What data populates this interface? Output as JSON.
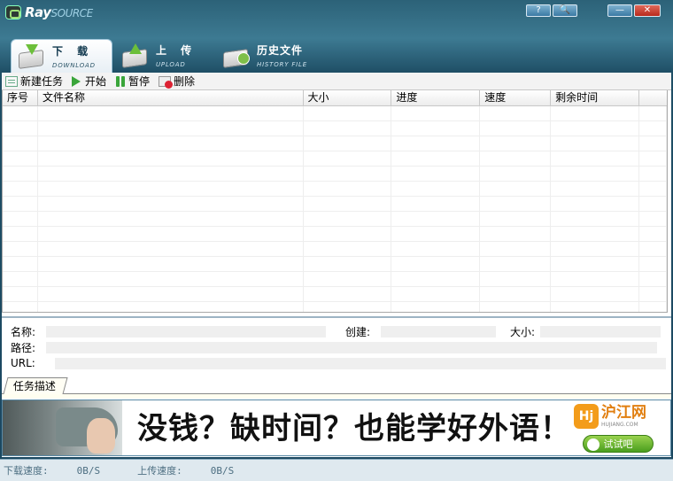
{
  "window": {
    "logo_main": "Ray",
    "logo_sub": "SOURCE",
    "controls": {
      "help": "?",
      "search": "🔍",
      "minimize": "—",
      "close": "✕"
    }
  },
  "tabs": [
    {
      "cn": "下 载",
      "en": "DOWNLOAD",
      "icon": "download-icon",
      "active": true
    },
    {
      "cn": "上 传",
      "en": "UPLOAD",
      "icon": "upload-icon",
      "active": false
    },
    {
      "cn": "历史文件",
      "en": "HISTORY FILE",
      "icon": "history-icon",
      "active": false
    }
  ],
  "toolbar": {
    "new_task": "新建任务",
    "start": "开始",
    "pause": "暂停",
    "delete": "删除"
  },
  "table": {
    "columns": [
      "序号",
      "文件名称",
      "大小",
      "进度",
      "速度",
      "剩余时间"
    ],
    "rows": []
  },
  "detail": {
    "name_label": "名称:",
    "created_label": "创建:",
    "size_label": "大小:",
    "path_label": "路径:",
    "url_label": "URL:"
  },
  "task_tab": "任务描述",
  "banner": {
    "slogan": "没钱？缺时间？也能学好外语！",
    "brand_cn": "沪江网",
    "brand_en": "HUJIANG.COM",
    "cta": "试试吧"
  },
  "status": {
    "download_label": "下载速度:",
    "download_value": "0B/S",
    "upload_label": "上传速度:",
    "upload_value": "0B/S"
  }
}
